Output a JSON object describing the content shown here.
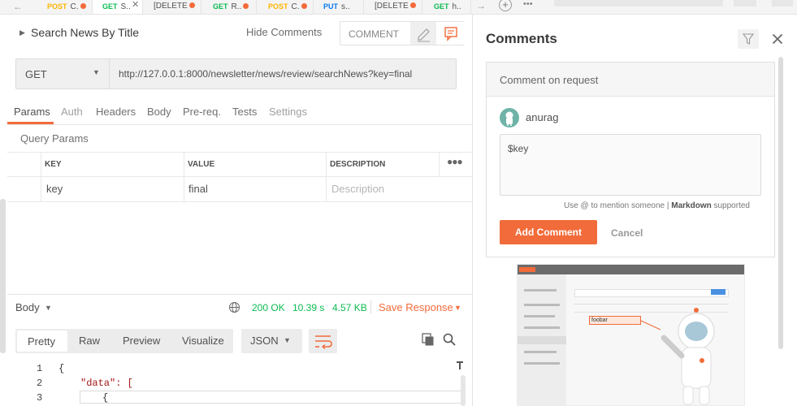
{
  "tabs": [
    {
      "method": "POST",
      "title": "C.",
      "dirty": true
    },
    {
      "method": "GET",
      "title": "S..",
      "dirty": false,
      "active": true
    },
    {
      "method": "",
      "title": "[DELETE",
      "dirty": true
    },
    {
      "method": "GET",
      "title": "R..",
      "dirty": true
    },
    {
      "method": "POST",
      "title": "C.",
      "dirty": true
    },
    {
      "method": "PUT",
      "title": "s..",
      "dirty": false
    },
    {
      "method": "",
      "title": "[DELETE",
      "dirty": true
    },
    {
      "method": "GET",
      "title": "h..",
      "dirty": false
    }
  ],
  "request": {
    "title": "Search News By Title",
    "hide_comments": "Hide Comments",
    "comment_label": "COMMENT",
    "method": "GET",
    "url": "http://127.0.0.1:8000/newsletter/news/review/searchNews?key=final"
  },
  "subtabs": [
    "Params",
    "Auth",
    "Headers",
    "Body",
    "Pre-req.",
    "Tests",
    "Settings"
  ],
  "query_params_label": "Query Params",
  "table": {
    "headers": [
      "KEY",
      "VALUE",
      "DESCRIPTION"
    ],
    "row": {
      "key": "key",
      "value": "final",
      "description_placeholder": "Description"
    }
  },
  "response": {
    "body_label": "Body",
    "status": "200 OK",
    "time": "10.39 s",
    "size": "4.57 KB",
    "save": "Save Response",
    "views": [
      "Pretty",
      "Raw",
      "Preview",
      "Visualize"
    ],
    "format": "JSON",
    "lines": [
      {
        "n": "1",
        "text": "{"
      },
      {
        "n": "2",
        "text": "\"data\": ["
      },
      {
        "n": "3",
        "text": "{"
      }
    ]
  },
  "comments": {
    "title": "Comments",
    "section": "Comment on request",
    "user": "anurag",
    "text": "$key",
    "hint_pre": "Use @ to mention someone |",
    "hint_bold": "Markdown",
    "hint_post": "supported",
    "add": "Add Comment",
    "cancel": "Cancel",
    "illus_label": "foobar"
  },
  "colors": {
    "accent": "#f26b3a",
    "ok": "#0cbb52",
    "get": "#0cbb52",
    "post": "#ffb400",
    "put": "#097bed"
  }
}
